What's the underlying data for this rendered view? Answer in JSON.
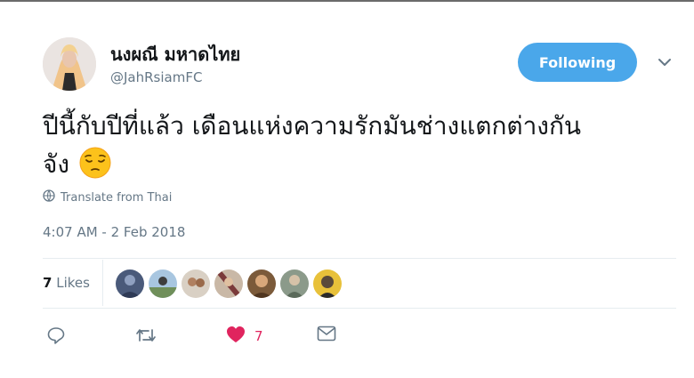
{
  "tweet": {
    "display_name": "นงผณี มหาดไทย",
    "handle": "@JahRsiamFC",
    "follow_label": "Following",
    "text_line1": "ปีนี้กับปีที่แล้ว เดือนแห่งความรักมันช่างแตกต่างกัน",
    "text_line2": "จัง",
    "emoji": "pensive-face",
    "translate_label": "Translate from Thai",
    "timestamp": "4:07 AM - 2 Feb 2018",
    "likes_count": "7",
    "likes_label": "Likes",
    "like_action_count": "7"
  },
  "colors": {
    "accent": "#4aa7ea",
    "like": "#e0245e",
    "muted": "#657786",
    "text": "#14171a"
  }
}
